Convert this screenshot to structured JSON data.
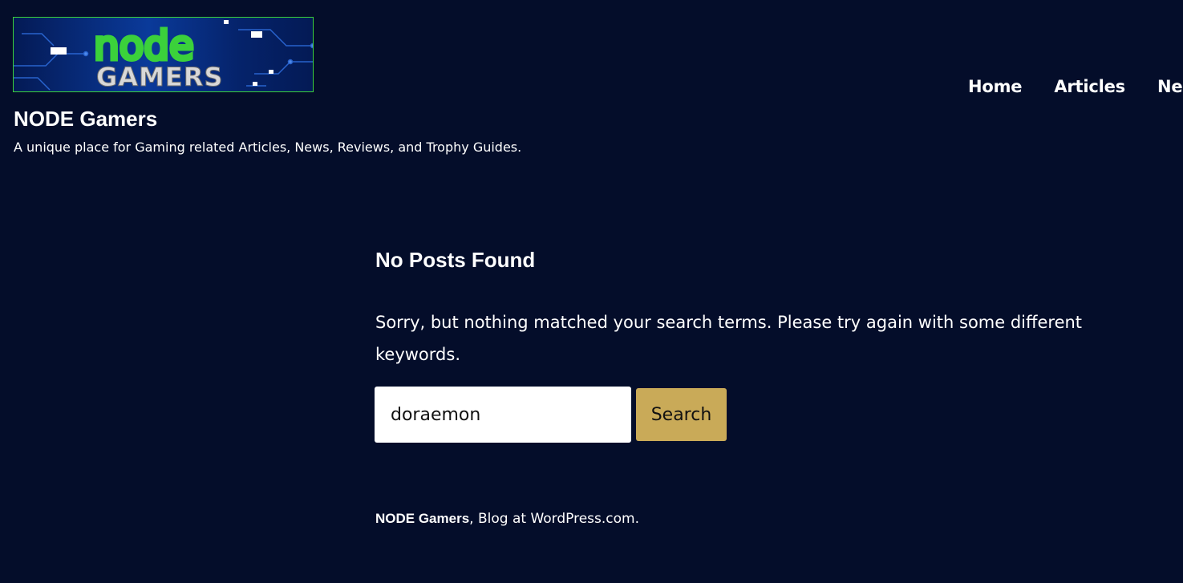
{
  "header": {
    "logo_text_top": "node",
    "logo_text_bottom": "GAMERS",
    "site_title": "NODE Gamers",
    "tagline": "A unique place for Gaming related Articles, News, Reviews, and Trophy Guides.",
    "nav": [
      {
        "label": "Home"
      },
      {
        "label": "Articles"
      },
      {
        "label": "News"
      }
    ]
  },
  "main": {
    "title": "No Posts Found",
    "message": "Sorry, but nothing matched your search terms. Please try again with some different keywords.",
    "search": {
      "value": "doraemon",
      "button_label": "Search"
    }
  },
  "footer": {
    "site_name": "NODE Gamers",
    "separator": ",",
    "wp_link": "Blog at WordPress.com",
    "period": "."
  },
  "colors": {
    "background": "#040d2a",
    "button": "#c9aa58",
    "logo_green": "#3bd13b"
  }
}
